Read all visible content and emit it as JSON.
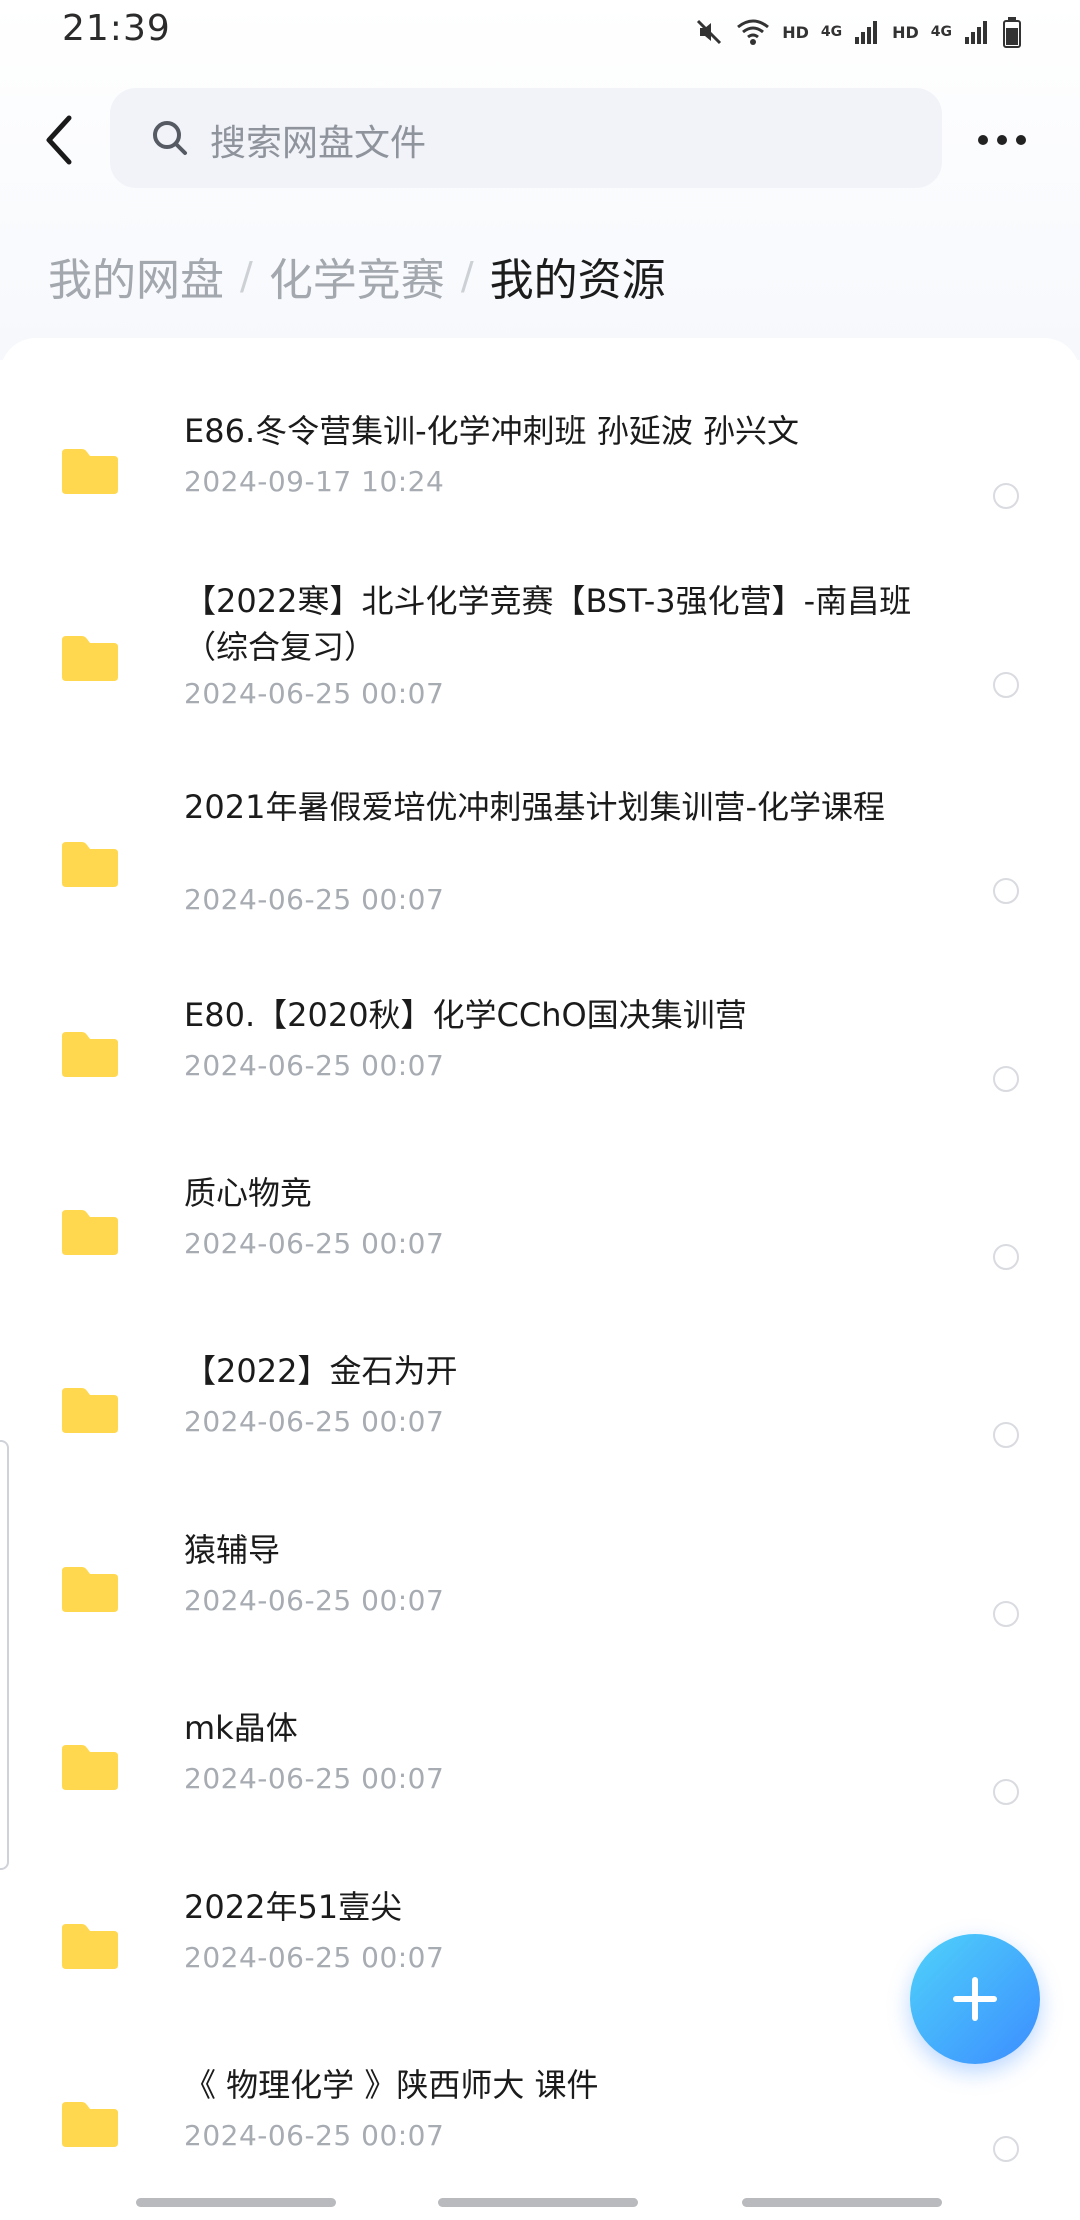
{
  "status_bar": {
    "time": "21:39",
    "icons": [
      "mute-icon",
      "wifi-icon",
      "signal-icon",
      "signal-icon",
      "battery-icon"
    ],
    "network_labels": [
      "HD",
      "4G",
      "HD",
      "4G"
    ]
  },
  "header": {
    "back_icon": "chevron-left-icon",
    "search_placeholder": "搜索网盘文件",
    "more_icon": "more-horizontal-icon"
  },
  "breadcrumb": {
    "items": [
      "我的网盘",
      "化学竞赛"
    ],
    "separator": "/",
    "current": "我的资源"
  },
  "files": [
    {
      "name": "E86.冬令营集训-化学冲刺班 孙延波 孙兴文",
      "date": "2024-09-17  10:24"
    },
    {
      "name": "【2022寒】北斗化学竞赛【BST-3强化营】-南昌班（综合复习）",
      "date": "2024-06-25  00:07"
    },
    {
      "name": "2021年暑假爱培优冲刺强基计划集训营-化学课程",
      "date": "2024-06-25  00:07"
    },
    {
      "name": "E80.【2020秋】化学CChO国决集训营",
      "date": "2024-06-25  00:07"
    },
    {
      "name": "质心物竞",
      "date": "2024-06-25  00:07"
    },
    {
      "name": "【2022】金石为开",
      "date": "2024-06-25  00:07"
    },
    {
      "name": "猿辅导",
      "date": "2024-06-25  00:07"
    },
    {
      "name": "mk晶体",
      "date": "2024-06-25  00:07"
    },
    {
      "name": "2022年51壹尖",
      "date": "2024-06-25  00:07"
    },
    {
      "name": "《 物理化学 》陕西师大 课件",
      "date": "2024-06-25  00:07"
    }
  ],
  "fab": {
    "icon": "plus-icon"
  },
  "colors": {
    "folder": "#FFD84F",
    "fab_start": "#4FD2FA",
    "fab_end": "#3C8DFF",
    "search_bg": "#F1F3F8",
    "secondary_text": "#A7ABB2"
  }
}
